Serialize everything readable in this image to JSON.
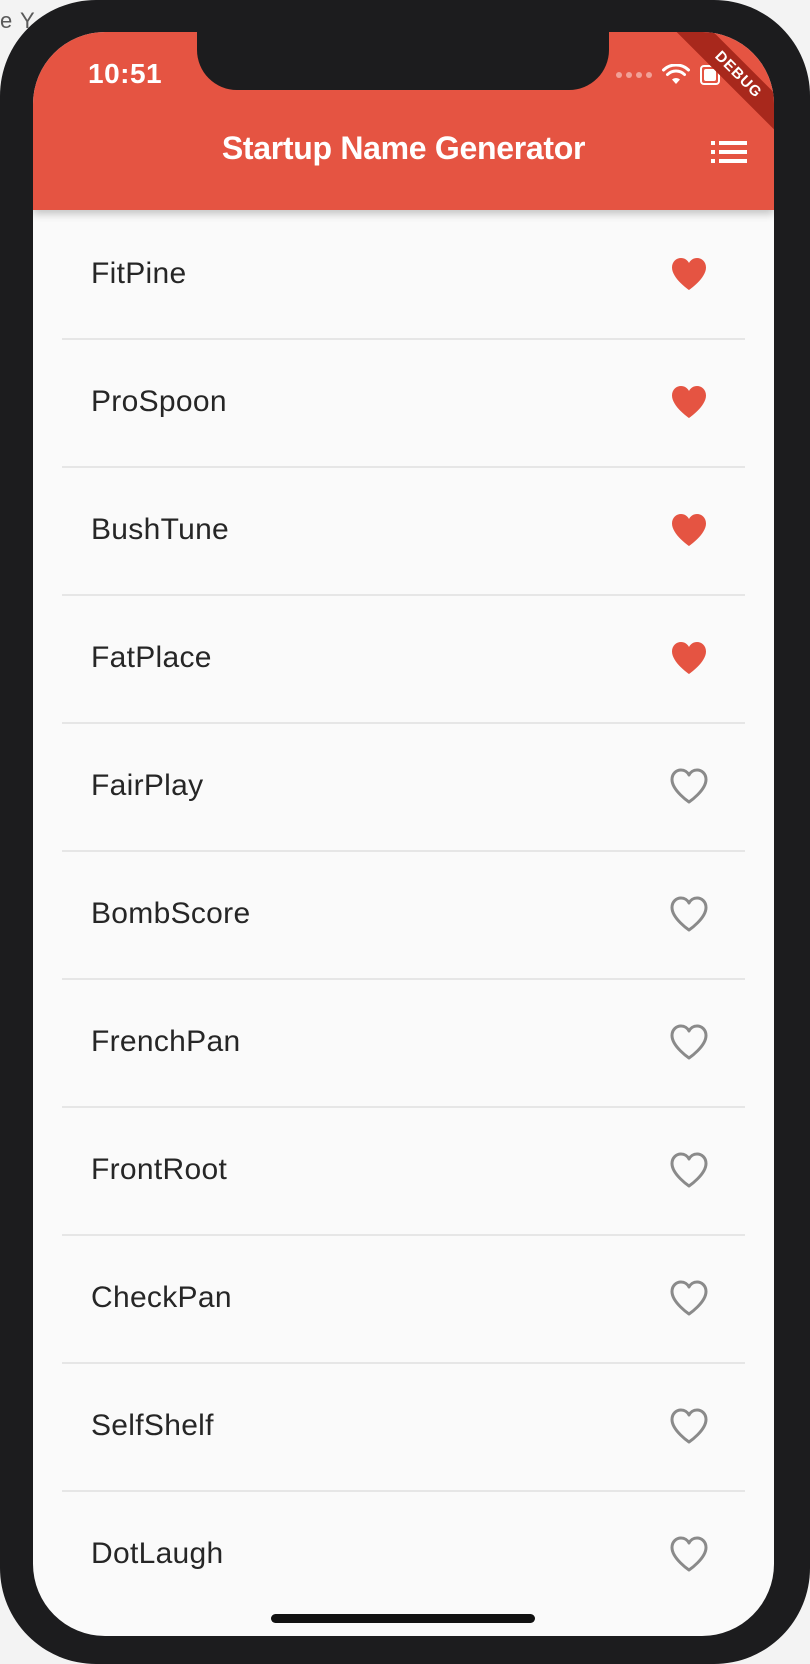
{
  "backdrop": {
    "text": "e Y"
  },
  "status_bar": {
    "time": "10:51",
    "icons": [
      "signal-dots-icon",
      "wifi-icon",
      "battery-icon"
    ]
  },
  "debug_banner": "DEBUG",
  "app_bar": {
    "title": "Startup Name Generator",
    "action_icon": "list-icon"
  },
  "colors": {
    "primary": "#e55442",
    "saved_heart": "#e55442",
    "unsaved_heart": "#8a8a8a",
    "background": "#fafafa"
  },
  "names": [
    {
      "label": "FitPine",
      "saved": true
    },
    {
      "label": "ProSpoon",
      "saved": true
    },
    {
      "label": "BushTune",
      "saved": true
    },
    {
      "label": "FatPlace",
      "saved": true
    },
    {
      "label": "FairPlay",
      "saved": false
    },
    {
      "label": "BombScore",
      "saved": false
    },
    {
      "label": "FrenchPan",
      "saved": false
    },
    {
      "label": "FrontRoot",
      "saved": false
    },
    {
      "label": "CheckPan",
      "saved": false
    },
    {
      "label": "SelfShelf",
      "saved": false
    },
    {
      "label": "DotLaugh",
      "saved": false
    }
  ]
}
